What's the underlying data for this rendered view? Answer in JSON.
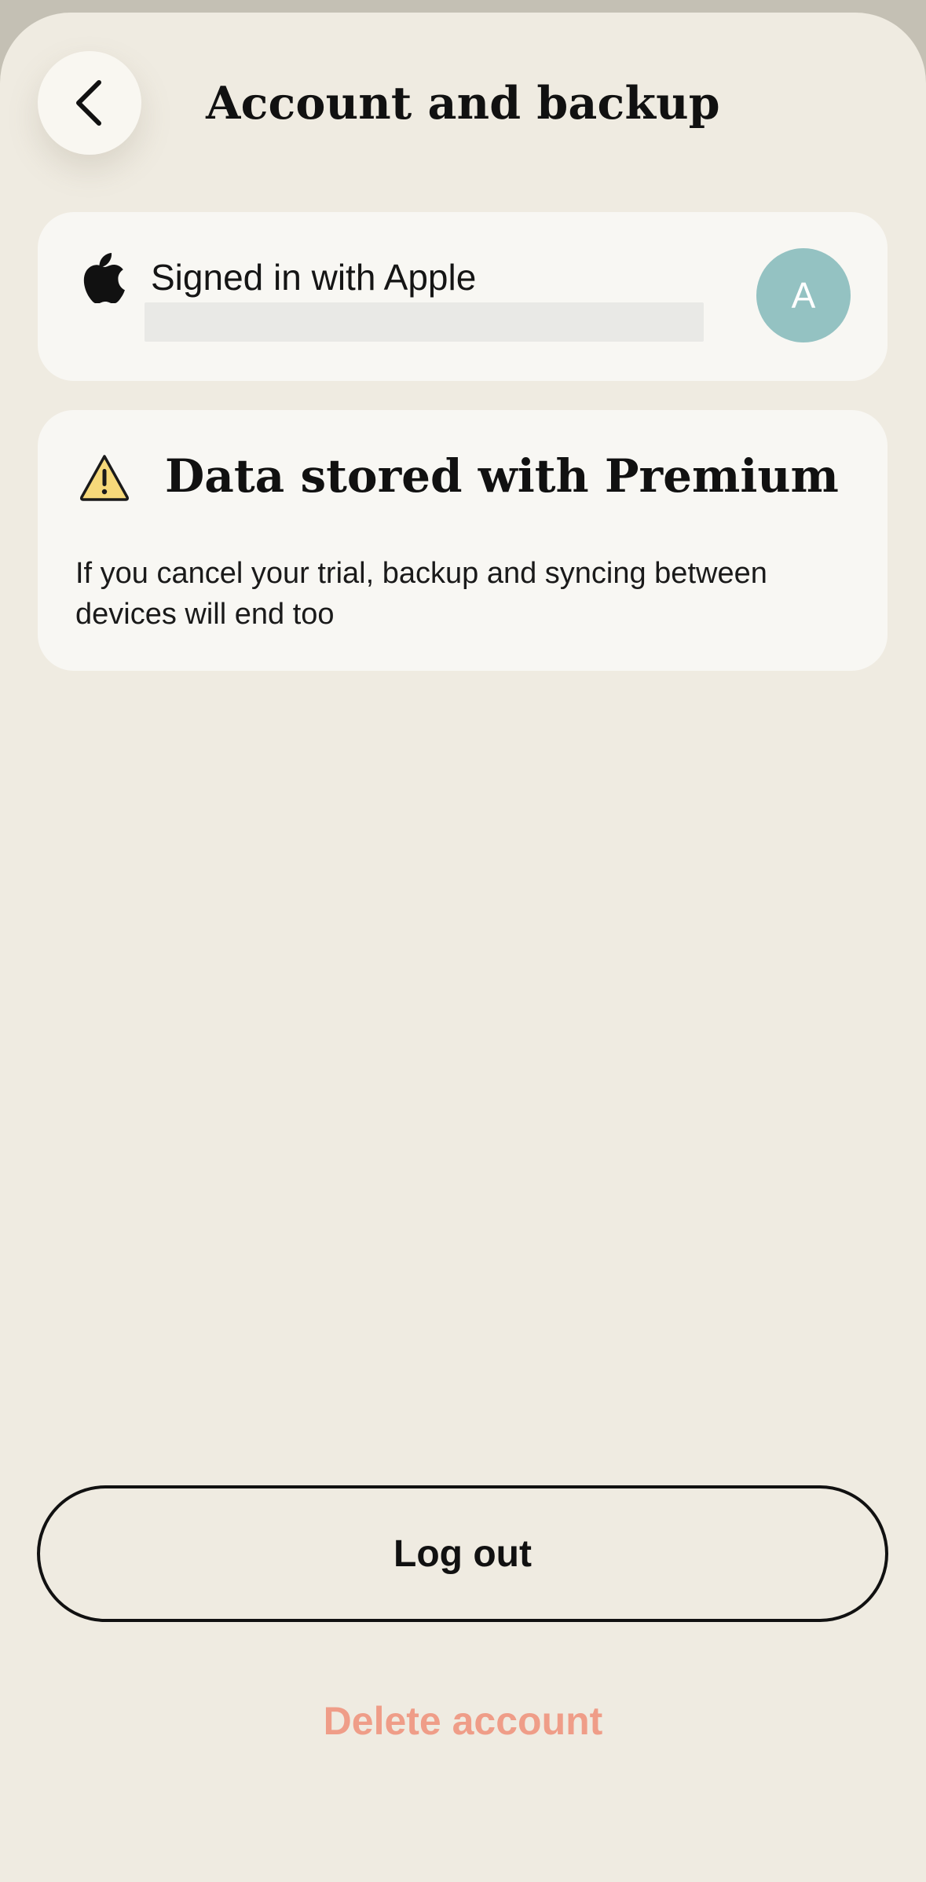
{
  "header": {
    "title": "Account and backup",
    "back_icon": "chevron-left-icon"
  },
  "account_card": {
    "provider_icon": "apple-logo-icon",
    "signed_in_label": "Signed in with Apple",
    "avatar_initial": "A",
    "avatar_color": "#94c2c2"
  },
  "premium_card": {
    "icon": "warning-triangle-icon",
    "title": "Data stored with Premium",
    "description": "If you cancel your trial, backup and syncing between devices will end too"
  },
  "actions": {
    "logout_label": "Log out",
    "delete_label": "Delete account",
    "delete_color": "#ef9d88"
  },
  "colors": {
    "background": "#efebe1",
    "card": "#f8f7f3",
    "warning_fill": "#f6d97a"
  }
}
